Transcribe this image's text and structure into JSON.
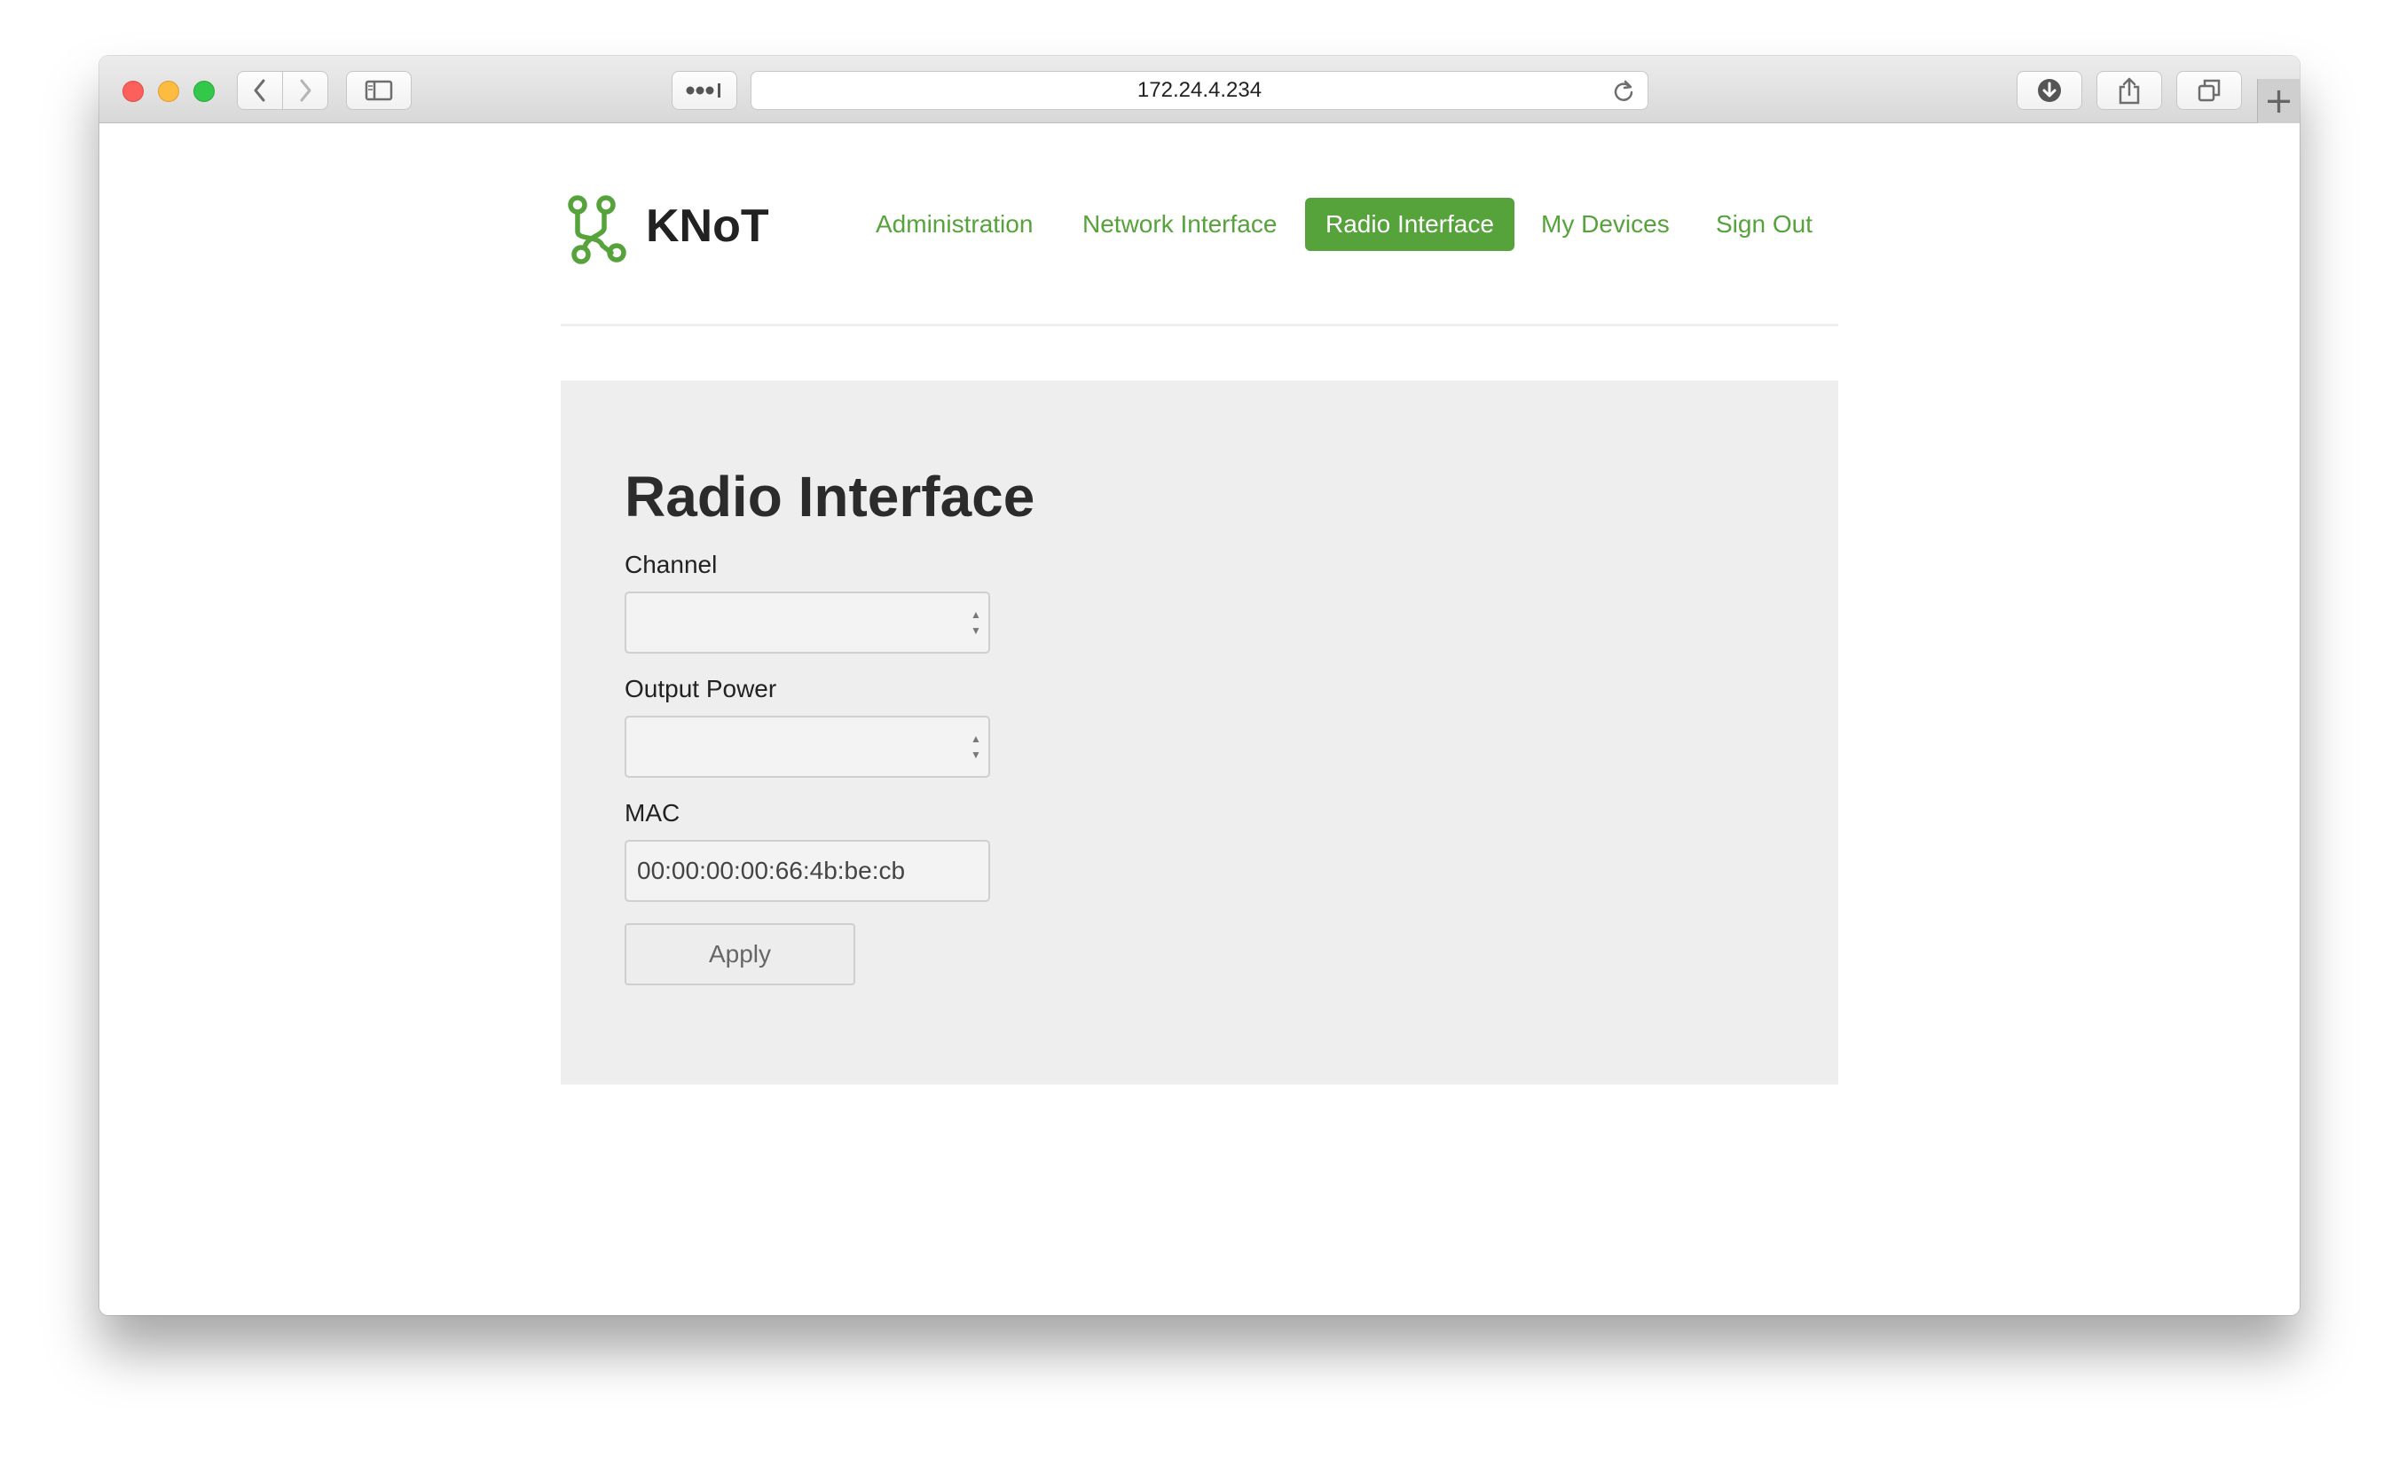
{
  "browser": {
    "url": "172.24.4.234",
    "icons": {
      "back": "chevron-left-icon",
      "forward": "chevron-right-icon",
      "sidebar": "sidebar-icon",
      "reader": "reader-icon",
      "reload": "reload-icon",
      "download": "download-icon",
      "share": "share-icon",
      "tabs": "tabs-icon",
      "new_tab": "plus-icon"
    }
  },
  "header": {
    "brand": "KNoT",
    "accent_color": "#56a23b",
    "nav": [
      {
        "label": "Administration",
        "active": false
      },
      {
        "label": "Network Interface",
        "active": false
      },
      {
        "label": "Radio Interface",
        "active": true
      },
      {
        "label": "My Devices",
        "active": false
      },
      {
        "label": "Sign Out",
        "active": false
      }
    ]
  },
  "form": {
    "title": "Radio Interface",
    "channel_label": "Channel",
    "channel_value": "",
    "output_power_label": "Output Power",
    "output_power_value": "",
    "mac_label": "MAC",
    "mac_value": "00:00:00:00:66:4b:be:cb",
    "apply_label": "Apply"
  }
}
